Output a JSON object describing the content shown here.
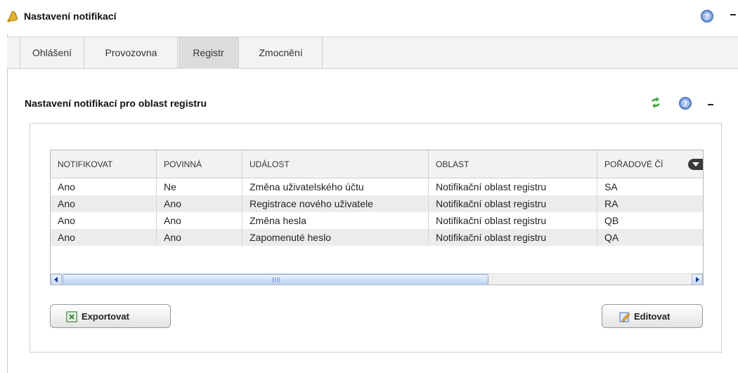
{
  "header": {
    "title": "Nastavení notifikací",
    "icon": "bell-icon"
  },
  "tabs": [
    {
      "label": "Ohlášení"
    },
    {
      "label": "Provozovna"
    },
    {
      "label": "Registr",
      "active": true
    },
    {
      "label": "Zmocnění"
    }
  ],
  "section": {
    "title": "Nastavení notifikací pro oblast registru"
  },
  "table": {
    "columns": [
      "NOTIFIKOVAT",
      "POVINNÁ",
      "UDÁLOST",
      "OBLAST",
      "POŘADOVÉ ČÍ"
    ],
    "rows": [
      [
        "Ano",
        "Ne",
        "Změna uživatelského účtu",
        "Notifikační oblast registru",
        "SA"
      ],
      [
        "Ano",
        "Ano",
        "Registrace nového uživatele",
        "Notifikační oblast registru",
        "RA"
      ],
      [
        "Ano",
        "Ano",
        "Změna hesla",
        "Notifikační oblast registru",
        "QB"
      ],
      [
        "Ano",
        "Ano",
        "Zapomenuté heslo",
        "Notifikační oblast registru",
        "QA"
      ]
    ]
  },
  "buttons": {
    "export_label": "Exportovat",
    "edit_label": "Editovat"
  },
  "colors": {
    "active_tab": "#dcdcdc",
    "tabbar": "#f3f3f3",
    "row_alt": "#ececec",
    "scroll_accent": "#bcd3f5"
  }
}
